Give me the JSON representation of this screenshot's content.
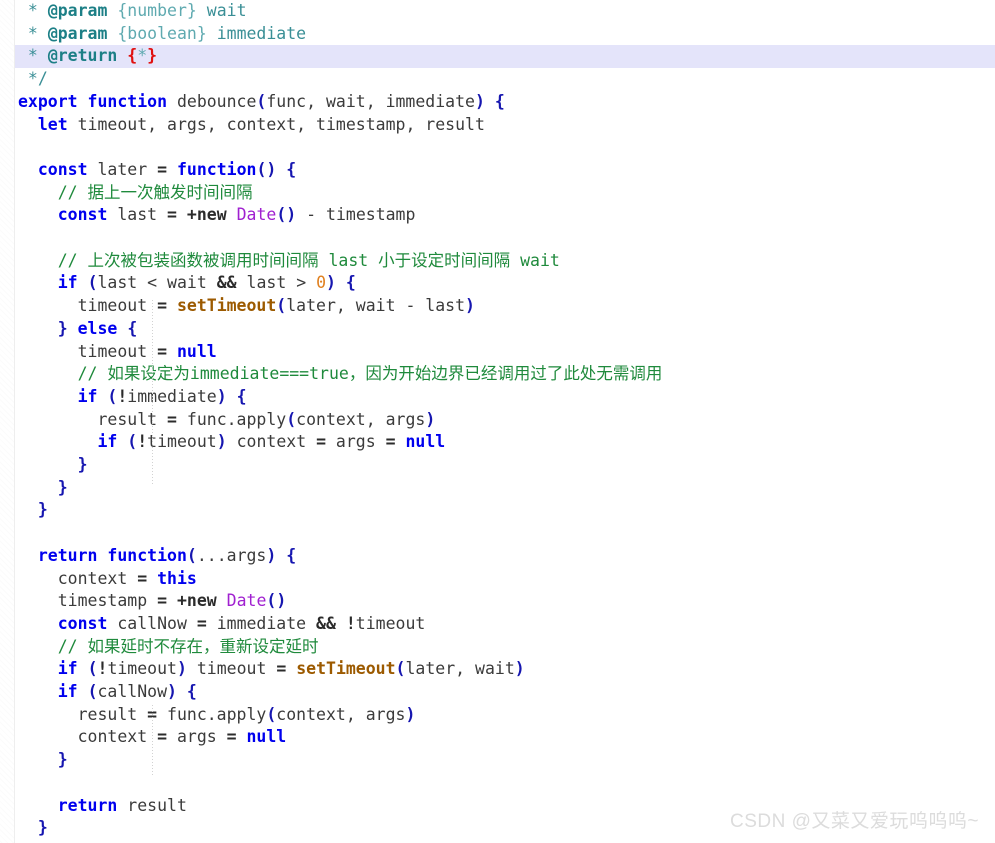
{
  "editor": {
    "language": "javascript",
    "background": "#ffffff",
    "current_line_highlight": "#e4e4fa",
    "default_text_color": "#3b3b3b"
  },
  "colors": {
    "keyword": "#0000ee",
    "punctuation": "#1616b0",
    "identifier": "#3b3b3b",
    "function": "#9c5a00",
    "class": "#a020d0",
    "number": "#e08020",
    "comment": "#1f8a3c",
    "doc_comment": "#3a8f96",
    "doc_tag": "#1c7f86",
    "error": "#e01010",
    "watermark": "#dcdcdc"
  },
  "watermark": {
    "text": "CSDN @又菜又爱玩呜呜呜~"
  },
  "gutter": {
    "fold_markers": [
      {
        "line": 4,
        "type": "fold-open"
      },
      {
        "line": 6,
        "type": "fold-open"
      },
      {
        "line": 9,
        "type": "fold-open"
      },
      {
        "line": 14,
        "type": "fold-open"
      },
      {
        "line": 23,
        "type": "fold-open"
      },
      {
        "line": 28,
        "type": "fold-open"
      }
    ],
    "dashes": [
      {
        "line": 3,
        "type": "red"
      },
      {
        "line": 11,
        "type": "gray"
      },
      {
        "line": 18,
        "type": "gray"
      },
      {
        "line": 19,
        "type": "gray"
      },
      {
        "line": 20,
        "type": "gray"
      },
      {
        "line": 31,
        "type": "gray"
      },
      {
        "line": 34,
        "type": "gray"
      }
    ]
  },
  "lines": [
    {
      "n": 1,
      "indent": 1,
      "highlight": false,
      "text": " * @param {number} wait"
    },
    {
      "n": 2,
      "indent": 1,
      "highlight": false,
      "text": " * @param {boolean} immediate"
    },
    {
      "n": 3,
      "indent": 1,
      "highlight": true,
      "text": " * @return {*}"
    },
    {
      "n": 4,
      "indent": 0,
      "highlight": false,
      "text": " */"
    },
    {
      "n": 5,
      "indent": 0,
      "highlight": false,
      "text": "export function debounce(func, wait, immediate) {"
    },
    {
      "n": 6,
      "indent": 1,
      "highlight": false,
      "text": "  let timeout, args, context, timestamp, result"
    },
    {
      "n": 7,
      "indent": 0,
      "highlight": false,
      "text": ""
    },
    {
      "n": 8,
      "indent": 1,
      "highlight": false,
      "text": "  const later = function() {"
    },
    {
      "n": 9,
      "indent": 2,
      "highlight": false,
      "text": "    // 据上一次触发时间间隔"
    },
    {
      "n": 10,
      "indent": 2,
      "highlight": false,
      "text": "    const last = +new Date() - timestamp"
    },
    {
      "n": 11,
      "indent": 0,
      "highlight": false,
      "text": ""
    },
    {
      "n": 12,
      "indent": 2,
      "highlight": false,
      "text": "    // 上次被包装函数被调用时间间隔 last 小于设定时间间隔 wait"
    },
    {
      "n": 13,
      "indent": 2,
      "highlight": false,
      "text": "    if (last < wait && last > 0) {"
    },
    {
      "n": 14,
      "indent": 3,
      "highlight": false,
      "text": "      timeout = setTimeout(later, wait - last)"
    },
    {
      "n": 15,
      "indent": 2,
      "highlight": false,
      "text": "    } else {"
    },
    {
      "n": 16,
      "indent": 3,
      "highlight": false,
      "text": "      timeout = null"
    },
    {
      "n": 17,
      "indent": 3,
      "highlight": false,
      "text": "      // 如果设定为immediate===true，因为开始边界已经调用过了此处无需调用"
    },
    {
      "n": 18,
      "indent": 3,
      "highlight": false,
      "text": "      if (!immediate) {"
    },
    {
      "n": 19,
      "indent": 4,
      "highlight": false,
      "text": "        result = func.apply(context, args)"
    },
    {
      "n": 20,
      "indent": 4,
      "highlight": false,
      "text": "        if (!timeout) context = args = null"
    },
    {
      "n": 21,
      "indent": 3,
      "highlight": false,
      "text": "      }"
    },
    {
      "n": 22,
      "indent": 2,
      "highlight": false,
      "text": "    }"
    },
    {
      "n": 23,
      "indent": 1,
      "highlight": false,
      "text": "  }"
    },
    {
      "n": 24,
      "indent": 0,
      "highlight": false,
      "text": ""
    },
    {
      "n": 25,
      "indent": 1,
      "highlight": false,
      "text": "  return function(...args) {"
    },
    {
      "n": 26,
      "indent": 2,
      "highlight": false,
      "text": "    context = this"
    },
    {
      "n": 27,
      "indent": 2,
      "highlight": false,
      "text": "    timestamp = +new Date()"
    },
    {
      "n": 28,
      "indent": 2,
      "highlight": false,
      "text": "    const callNow = immediate && !timeout"
    },
    {
      "n": 29,
      "indent": 2,
      "highlight": false,
      "text": "    // 如果延时不存在，重新设定延时"
    },
    {
      "n": 30,
      "indent": 2,
      "highlight": false,
      "text": "    if (!timeout) timeout = setTimeout(later, wait)"
    },
    {
      "n": 31,
      "indent": 2,
      "highlight": false,
      "text": "    if (callNow) {"
    },
    {
      "n": 32,
      "indent": 3,
      "highlight": false,
      "text": "      result = func.apply(context, args)"
    },
    {
      "n": 33,
      "indent": 3,
      "highlight": false,
      "text": "      context = args = null"
    },
    {
      "n": 34,
      "indent": 2,
      "highlight": false,
      "text": "    }"
    },
    {
      "n": 35,
      "indent": 0,
      "highlight": false,
      "text": ""
    },
    {
      "n": 36,
      "indent": 2,
      "highlight": false,
      "text": "    return result"
    },
    {
      "n": 37,
      "indent": 1,
      "highlight": false,
      "text": "  }"
    }
  ]
}
